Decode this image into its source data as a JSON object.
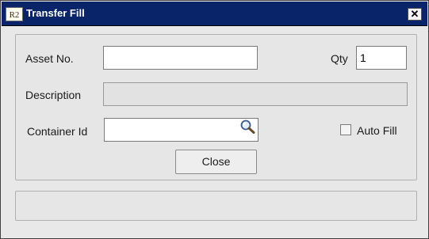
{
  "window": {
    "title": "Transfer Fill",
    "app_icon_text": "R2",
    "close_glyph": "✕"
  },
  "form": {
    "asset_no": {
      "label": "Asset No.",
      "value": ""
    },
    "qty": {
      "label": "Qty",
      "value": "1"
    },
    "description": {
      "label": "Description",
      "value": ""
    },
    "container_id": {
      "label": "Container Id",
      "value": "",
      "icon": "search-icon"
    },
    "auto_fill": {
      "label": "Auto Fill",
      "checked": false
    },
    "close_button_label": "Close"
  },
  "status_bar": {
    "text": ""
  }
}
